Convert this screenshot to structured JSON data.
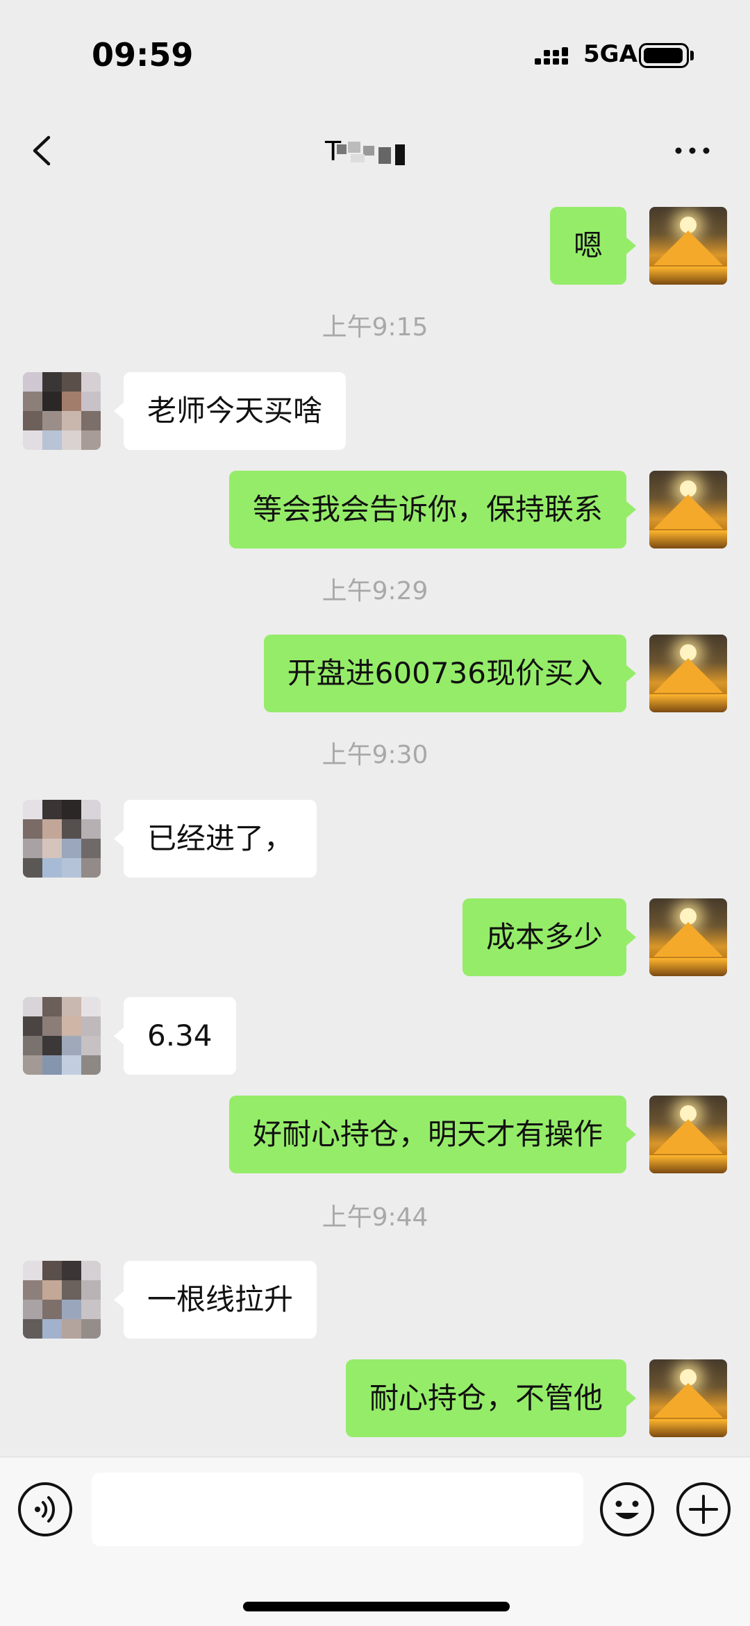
{
  "status_bar": {
    "time": "09:59",
    "network": "5GA"
  },
  "header": {
    "title": "T",
    "back_icon": "chevron-left-icon",
    "more_icon": "more-dots-icon"
  },
  "messages": [
    {
      "sender": "self",
      "text": "嗯"
    },
    {
      "timestamp": "上午9:15"
    },
    {
      "sender": "other",
      "text": "老师今天买啥"
    },
    {
      "sender": "self",
      "text": "等会我会告诉你，保持联系"
    },
    {
      "timestamp": "上午9:29"
    },
    {
      "sender": "self",
      "text": "开盘进600736现价买入"
    },
    {
      "timestamp": "上午9:30"
    },
    {
      "sender": "other",
      "text": "已经进了，"
    },
    {
      "sender": "self",
      "text": "成本多少"
    },
    {
      "sender": "other",
      "text": "6.34"
    },
    {
      "sender": "self",
      "text": "好耐心持仓，明天才有操作"
    },
    {
      "timestamp": "上午9:44"
    },
    {
      "sender": "other",
      "text": "一根线拉升"
    },
    {
      "sender": "self",
      "text": "耐心持仓，不管他"
    }
  ],
  "input_bar": {
    "voice_icon": "voice-icon",
    "input_value": "",
    "emoji_icon": "emoji-icon",
    "plus_icon": "plus-icon"
  },
  "colors": {
    "background": "#ededed",
    "self_bubble": "#95ec69",
    "other_bubble": "#ffffff",
    "timestamp_text": "#a8a8a8"
  }
}
